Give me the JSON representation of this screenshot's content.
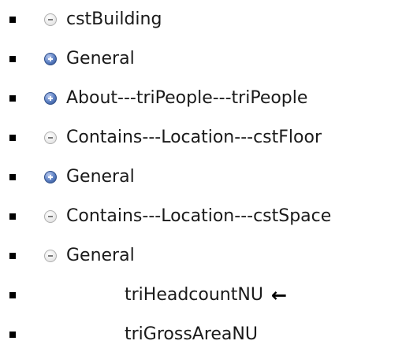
{
  "tree": {
    "items": [
      {
        "label": "cstBuilding",
        "toggle": "collapse"
      },
      {
        "label": "General",
        "toggle": "expand"
      },
      {
        "label": "About---triPeople---triPeople",
        "toggle": "expand"
      },
      {
        "label": "Contains---Location---cstFloor",
        "toggle": "collapse"
      },
      {
        "label": "General",
        "toggle": "expand"
      },
      {
        "label": "Contains---Location---cstSpace",
        "toggle": "collapse"
      },
      {
        "label": "General",
        "toggle": "collapse"
      },
      {
        "label": "triHeadcountNU",
        "toggle": "none",
        "marker": "←"
      },
      {
        "label": "triGrossAreaNU",
        "toggle": "none"
      }
    ]
  },
  "colors": {
    "text": "#1a1a1a",
    "expand_icon": "#2b4a86",
    "collapse_icon": "#cfcfcf"
  }
}
